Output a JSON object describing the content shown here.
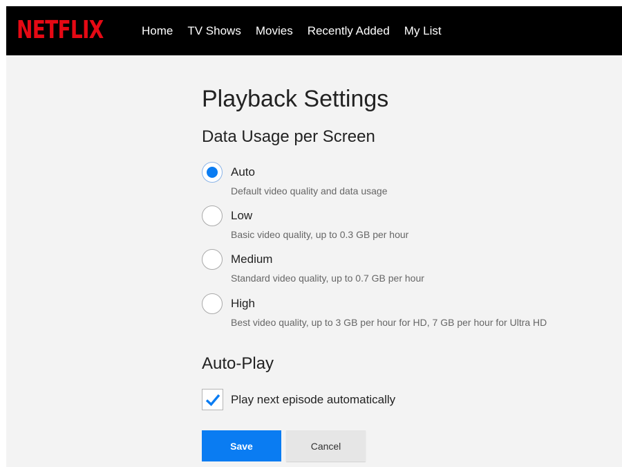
{
  "brand": {
    "logo_text": "NETFLIX",
    "logo_color": "#e50914"
  },
  "nav": {
    "items": [
      "Home",
      "TV Shows",
      "Movies",
      "Recently Added",
      "My List"
    ]
  },
  "page": {
    "title": "Playback Settings"
  },
  "data_usage": {
    "title": "Data Usage per Screen",
    "selected": "Auto",
    "options": [
      {
        "label": "Auto",
        "description": "Default video quality and data usage"
      },
      {
        "label": "Low",
        "description": "Basic video quality, up to 0.3 GB per hour"
      },
      {
        "label": "Medium",
        "description": "Standard video quality, up to 0.7 GB per hour"
      },
      {
        "label": "High",
        "description": "Best video quality, up to 3 GB per hour for HD, 7 GB per hour for Ultra HD"
      }
    ]
  },
  "auto_play": {
    "title": "Auto-Play",
    "checkbox_label": "Play next episode automatically",
    "checked": true
  },
  "actions": {
    "save_label": "Save",
    "cancel_label": "Cancel"
  },
  "colors": {
    "accent": "#0a7cf2",
    "topbar": "#000000",
    "background": "#f3f3f3"
  }
}
